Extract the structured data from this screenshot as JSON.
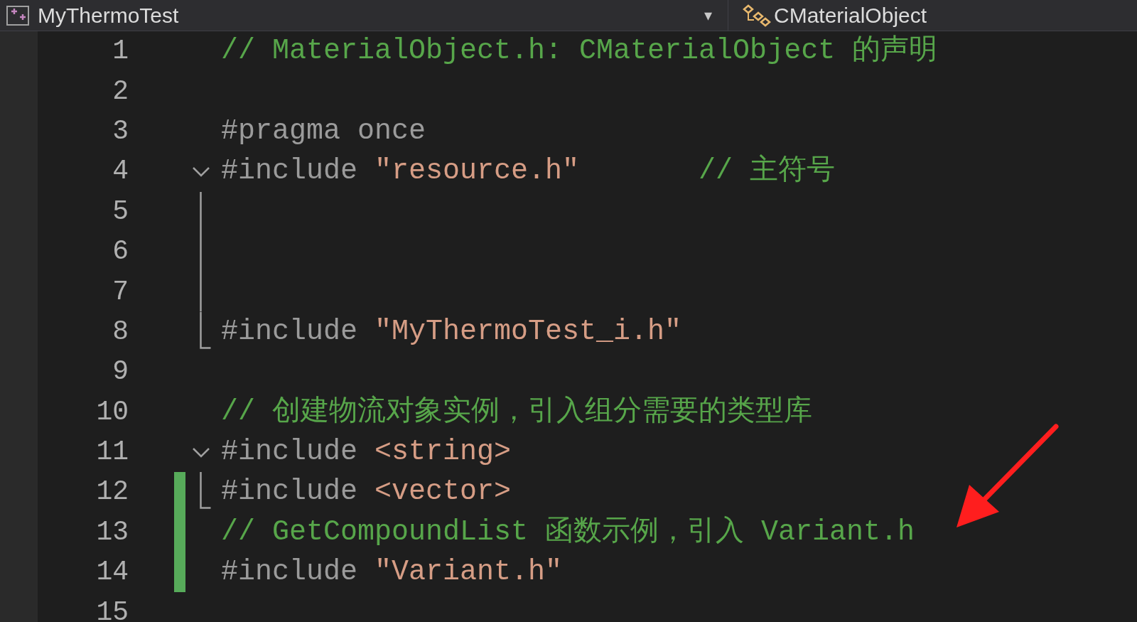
{
  "navigation_bar": {
    "project": "MyThermoTest",
    "dropdown_arrow": "▾",
    "scope": "CMaterialObject"
  },
  "lines": [
    {
      "number": "1",
      "changed": false,
      "kind": "plain",
      "tokens": [
        {
          "kind": "comment",
          "text": "// MaterialObject.h: CMaterialObject 的声明"
        }
      ]
    },
    {
      "number": "2",
      "changed": false,
      "kind": "plain"
    },
    {
      "number": "3",
      "changed": false,
      "kind": "plain",
      "tokens": [
        {
          "kind": "directive",
          "text": "#pragma once"
        }
      ]
    },
    {
      "number": "4",
      "changed": false,
      "kind": "fold_start",
      "tokens": [
        {
          "kind": "directive",
          "text": "#include"
        },
        {
          "kind": "string",
          "text": "\"resource.h\""
        },
        {
          "kind": "comment",
          "text": "// 主符号"
        }
      ]
    },
    {
      "number": "5",
      "changed": false,
      "kind": "fold_inside"
    },
    {
      "number": "6",
      "changed": false,
      "kind": "fold_inside"
    },
    {
      "number": "7",
      "changed": false,
      "kind": "fold_inside"
    },
    {
      "number": "8",
      "changed": false,
      "kind": "fold_end",
      "tokens": [
        {
          "kind": "directive",
          "text": "#include"
        },
        {
          "kind": "string",
          "text": "\"MyThermoTest_i.h\""
        }
      ]
    },
    {
      "number": "9",
      "changed": false,
      "kind": "plain"
    },
    {
      "number": "10",
      "changed": false,
      "kind": "plain",
      "tokens": [
        {
          "kind": "comment",
          "text": "// 创建物流对象实例，引入组分需要的类型库"
        }
      ]
    },
    {
      "number": "11",
      "changed": false,
      "kind": "fold_start",
      "tokens": [
        {
          "kind": "directive",
          "text": "#include"
        },
        {
          "kind": "string",
          "text": "<string>"
        }
      ]
    },
    {
      "number": "12",
      "changed": true,
      "kind": "fold_end",
      "tokens": [
        {
          "kind": "directive",
          "text": "#include"
        },
        {
          "kind": "string",
          "text": "<vector>"
        }
      ]
    },
    {
      "number": "13",
      "changed": true,
      "kind": "plain",
      "tokens": [
        {
          "kind": "comment",
          "text": "// GetCompoundList 函数示例，引入 Variant.h"
        }
      ]
    },
    {
      "number": "14",
      "changed": true,
      "kind": "plain",
      "tokens": [
        {
          "kind": "directive",
          "text": "#include"
        },
        {
          "kind": "string",
          "text": "\"Variant.h\""
        }
      ]
    },
    {
      "number": "15",
      "changed": false,
      "kind": "plain"
    }
  ]
}
